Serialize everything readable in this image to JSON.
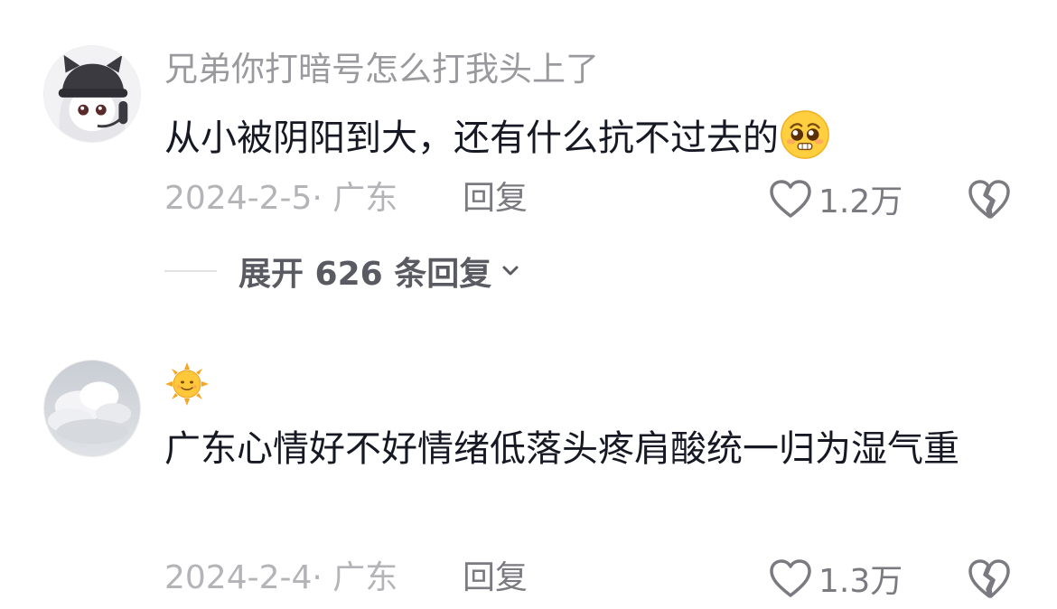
{
  "comments": [
    {
      "avatar_icon": "anime-girl-cat-ear-headphones-avatar",
      "username": "兄弟你打暗号怎么打我头上了",
      "text": "从小被阴阳到大，还有什么抗不过去的",
      "trailing_emoji": "pleading-face-emoji",
      "date": "2024-2-5",
      "location": "广东",
      "reply_label": "回复",
      "like_count": "1.2万",
      "expand_replies_label": "展开 626 条回复"
    },
    {
      "avatar_icon": "cloud-sky-avatar",
      "username_emoji": "sun-with-face-emoji",
      "text": "广东心情好不好情绪低落头疼肩酸统一归为湿气重",
      "date": "2024-2-4",
      "location": "广东",
      "reply_label": "回复",
      "like_count": "1.3万"
    }
  ],
  "meta_separator": "· ",
  "colors": {
    "primary_text": "#161823",
    "secondary_text": "#9a9a9e",
    "meta_text": "#b4b4b8",
    "action_text": "#7a7a80"
  }
}
